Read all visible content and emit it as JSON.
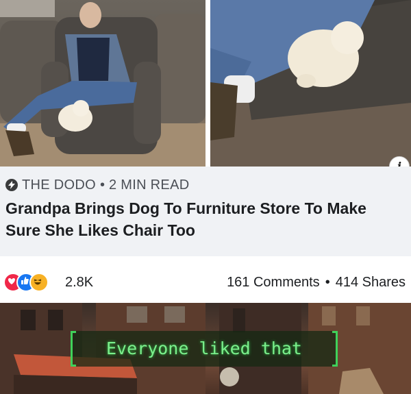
{
  "photos": {
    "left_alt_name": "grandpa-in-recliner-photo",
    "right_alt_name": "dog-on-recliner-photo"
  },
  "info_icon": {
    "glyph": "i"
  },
  "article": {
    "source": "THE DODO",
    "separator": "•",
    "read_time": "2 MIN READ",
    "headline": "Grandpa Brings Dog To Furniture Store To Make Sure She Likes Chair Too"
  },
  "reactions": {
    "types": [
      "love",
      "like",
      "haha"
    ],
    "count": "2.8K",
    "comments": "161 Comments",
    "separator": "•",
    "shares": "414 Shares"
  },
  "game_notification": {
    "text": "Everyone liked that"
  },
  "colors": {
    "card_bg": "#f0f2f5",
    "headline": "#1c1e21",
    "love": "#f02849",
    "like": "#1877f2",
    "haha": "#f7b125",
    "pipboy_green": "#3fd15a"
  }
}
